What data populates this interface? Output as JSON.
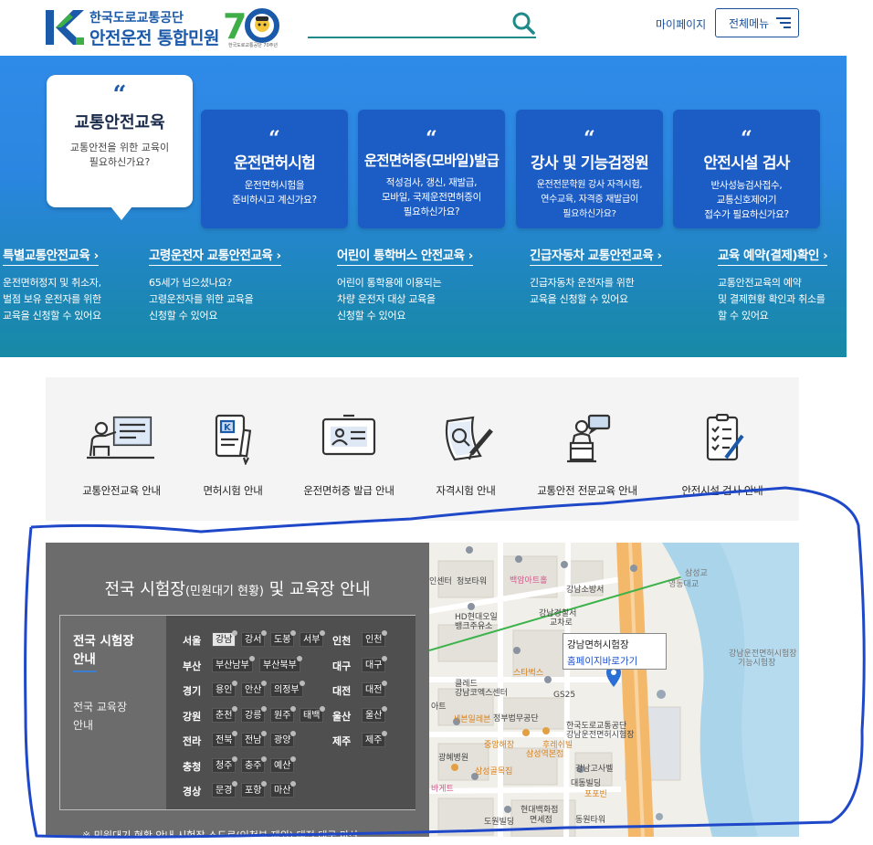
{
  "header": {
    "org_name": "한국도로교통공단",
    "service_name": "안전운전 통합민원",
    "anniversary_sub": "한국도로교통공단 70주년",
    "search_placeholder": "",
    "mypage_label": "마이페이지",
    "allmenu_label": "전체메뉴"
  },
  "hero": {
    "featured": {
      "title": "교통안전교육",
      "desc_line1": "교통안전을 위한 교육이",
      "desc_line2": "필요하신가요?"
    },
    "cards": [
      {
        "title": "운전면허시험",
        "l1": "운전면허시험을",
        "l2": "준비하시고 계신가요?",
        "l3": ""
      },
      {
        "title": "운전면허증(모바일)발급",
        "l1": "적성검사, 갱신, 재발급,",
        "l2": "모바일, 국제운전면허증이",
        "l3": "필요하신가요?"
      },
      {
        "title": "강사 및 기능검정원",
        "l1": "운전전문학원 강사 자격시험,",
        "l2": "연수교육, 자격증 재발급이",
        "l3": "필요하신가요?"
      },
      {
        "title": "안전시설 검사",
        "l1": "반사성능검사접수,",
        "l2": "교통신호제어기",
        "l3": "접수가 필요하신가요?"
      }
    ],
    "links": [
      {
        "title": "특별교통안전교육",
        "l1": "운전면허정지 및 취소자,",
        "l2": "벌점 보유 운전자를 위한",
        "l3": "교육을 신청할 수 있어요"
      },
      {
        "title": "고령운전자 교통안전교육",
        "l1": "65세가 넘으셨나요?",
        "l2": "고령운전자를 위한 교육을",
        "l3": "신청할 수 있어요"
      },
      {
        "title": "어린이 통학버스 안전교육",
        "l1": "어린이 통학용에 이용되는",
        "l2": "차량 운전자 대상 교육을",
        "l3": "신청할 수 있어요"
      },
      {
        "title": "긴급자동차 교통안전교육",
        "l1": "긴급자동차 운전자를 위한",
        "l2": "교육을 신청할 수 있어요",
        "l3": ""
      },
      {
        "title": "교육 예약(결제)확인",
        "l1": "교통안전교육의 예약",
        "l2": "및 결제현황 확인과 취소를",
        "l3": "할 수 있어요"
      }
    ]
  },
  "quick_menu": [
    {
      "label": "교통안전교육 안내",
      "icon": "lecture-board-icon"
    },
    {
      "label": "면허시험 안내",
      "icon": "license-document-icon"
    },
    {
      "label": "운전면허증 발급 안내",
      "icon": "id-card-icon"
    },
    {
      "label": "자격시험 안내",
      "icon": "exam-pencil-icon"
    },
    {
      "label": "교통안전 전문교육 안내",
      "icon": "speaker-podium-icon"
    },
    {
      "label": "안전시설 검사 안내",
      "icon": "checklist-icon"
    }
  ],
  "exam": {
    "title_main": "전국 시험장",
    "title_sub": "(민원대기 현황)",
    "title_end": "및 교육장 안내",
    "tab_active_l1": "전국 시험장",
    "tab_active_l2": "안내",
    "tab_other_l1": "전국 교육장",
    "tab_other_l2": "안내",
    "regions_left": [
      {
        "name": "서울",
        "sites": [
          "강남",
          "강서",
          "도봉",
          "서부"
        ]
      },
      {
        "name": "부산",
        "sites": [
          "부산남부",
          "부산북부"
        ]
      },
      {
        "name": "경기",
        "sites": [
          "용인",
          "안산",
          "의정부"
        ]
      },
      {
        "name": "강원",
        "sites": [
          "춘천",
          "강릉",
          "원주",
          "태백"
        ]
      },
      {
        "name": "전라",
        "sites": [
          "전북",
          "전남",
          "광양"
        ]
      },
      {
        "name": "충청",
        "sites": [
          "청주",
          "충주",
          "예산"
        ]
      },
      {
        "name": "경상",
        "sites": [
          "문경",
          "포항",
          "마산"
        ]
      }
    ],
    "regions_right": [
      {
        "name": "인천",
        "sites": [
          "인천"
        ]
      },
      {
        "name": "대구",
        "sites": [
          "대구"
        ]
      },
      {
        "name": "대전",
        "sites": [
          "대전"
        ]
      },
      {
        "name": "울산",
        "sites": [
          "울산"
        ]
      },
      {
        "name": "제주",
        "sites": [
          "제주"
        ]
      }
    ],
    "selected_site": "강남",
    "note": "※ 민원대기 현황 안내 시험장 스도로(인천부 제외) 대전 대구 마산"
  },
  "map": {
    "popup_title": "강남면허시험장",
    "popup_link": "홈페이지바로가기",
    "labels": [
      "인센터",
      "청보타워",
      "백암아트홀",
      "강남소방서",
      "강남경찰서",
      "교차로",
      "HD현대오일",
      "뱅크주유소",
      "영동대교",
      "삼성교",
      "스타벅스",
      "클레드",
      "강남코엑스센터",
      "GS25",
      "세븐일레븐",
      "정부법무공단",
      "한국도로교통공단",
      "강남운전면허시험장",
      "광혜병원",
      "중앙해장",
      "후레쉬빌",
      "삼성역본점",
      "삼성골목집",
      "강남고사벨",
      "대동빌딩",
      "포포빈",
      "현대백화점",
      "면세점",
      "도원빌딩",
      "동원타워",
      "강남운전면허시험장",
      "기능시험장",
      "바게트",
      "아트"
    ]
  }
}
